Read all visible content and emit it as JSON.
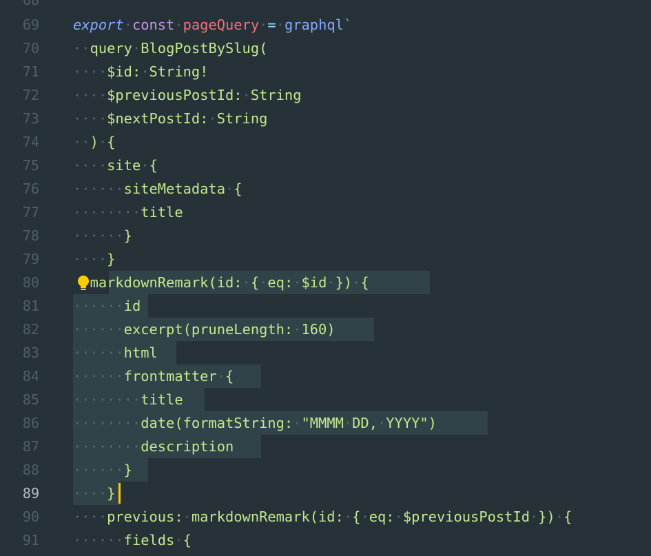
{
  "editor": {
    "line_numbers": [
      "68",
      "69",
      "70",
      "71",
      "72",
      "73",
      "74",
      "75",
      "76",
      "77",
      "78",
      "79",
      "80",
      "81",
      "82",
      "83",
      "84",
      "85",
      "86",
      "87",
      "88",
      "89",
      "90",
      "91"
    ],
    "current_line": "89",
    "code": {
      "l69": [
        "export",
        "const",
        "pageQuery",
        "=",
        "graphql`"
      ],
      "l70": "query BlogPostBySlug(",
      "l71": "$id: String!",
      "l72": "$previousPostId: String",
      "l73": "$nextPostId: String",
      "l74": ") {",
      "l75": "site {",
      "l76": "siteMetadata {",
      "l77": "title",
      "l78": "}",
      "l79": "}",
      "l80": "markdownRemark(id: { eq: $id }) {",
      "l81": "id",
      "l82": "excerpt(pruneLength: 160)",
      "l83": "html",
      "l84": "frontmatter {",
      "l85": "title",
      "l86": "date(formatString: \"MMMM DD, YYYY\")",
      "l87": "description",
      "l88": "}",
      "l89": "}",
      "l90": "previous: markdownRemark(id: { eq: $previousPostId }) {",
      "l91": "fields {"
    },
    "icons": {
      "lightbulb": "lightbulb-icon"
    },
    "colors": {
      "background": "#263238",
      "selection": "#324249",
      "string": "#c3e88d",
      "keyword": "#c792ea",
      "variable": "#f07178",
      "function": "#82aaff",
      "operator": "#89ddff",
      "cursor": "#ffcc00",
      "lightbulb": "#ffcc00"
    }
  }
}
